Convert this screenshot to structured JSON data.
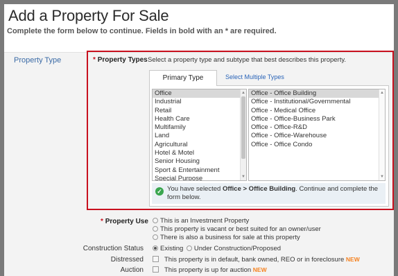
{
  "header": {
    "title": "Add a Property For Sale",
    "subtitle": "Complete the form below to continue. Fields in bold with an * are required."
  },
  "section": {
    "label": "Property Type"
  },
  "property_types": {
    "label": "Property Types",
    "required_marker": "*",
    "instruction": "Select a property type and subtype that best describes this property.",
    "tabs": [
      {
        "label": "Primary Type",
        "active": true
      },
      {
        "label": "Select Multiple Types",
        "active": false
      }
    ],
    "primary_types": [
      {
        "label": "Office",
        "selected": true
      },
      {
        "label": "Industrial"
      },
      {
        "label": "Retail"
      },
      {
        "label": "Health Care"
      },
      {
        "label": "Multifamily"
      },
      {
        "label": "Land"
      },
      {
        "label": "Agricultural"
      },
      {
        "label": "Hotel & Motel"
      },
      {
        "label": "Senior Housing"
      },
      {
        "label": "Sport & Entertainment"
      },
      {
        "label": "Special Purpose"
      }
    ],
    "subtypes": [
      {
        "label": "Office - Office Building",
        "selected": true
      },
      {
        "label": "Office - Institutional/Governmental"
      },
      {
        "label": "Office - Medical Office"
      },
      {
        "label": "Office - Office-Business Park"
      },
      {
        "label": "Office - Office-R&D"
      },
      {
        "label": "Office - Office-Warehouse"
      },
      {
        "label": "Office - Office Condo"
      }
    ],
    "confirmation": {
      "prefix": "You have selected ",
      "selection": "Office > Office Building",
      "suffix": ". Continue and complete the form below.",
      "icon": "check-circle-icon",
      "icon_color": "#3aa64f"
    }
  },
  "property_use": {
    "label": "Property Use",
    "required_marker": "*",
    "options": [
      {
        "label": "This is an Investment Property",
        "checked": false
      },
      {
        "label": "This property is vacant or best suited for an owner/user",
        "checked": false
      },
      {
        "label": "There is also a business for sale at this property",
        "checked": false
      }
    ]
  },
  "construction_status": {
    "label": "Construction Status",
    "options": [
      {
        "label": "Existing",
        "checked": true
      },
      {
        "label": "Under Construction/Proposed",
        "checked": false
      }
    ]
  },
  "distressed": {
    "label": "Distressed",
    "text": "This property is in default, bank owned, REO or in foreclosure",
    "badge": "NEW"
  },
  "auction": {
    "label": "Auction",
    "text": "This property is up for auction",
    "badge": "NEW"
  },
  "colors": {
    "accent_red": "#c8101e",
    "link_blue": "#2a64b8",
    "new_orange": "#f58220"
  }
}
